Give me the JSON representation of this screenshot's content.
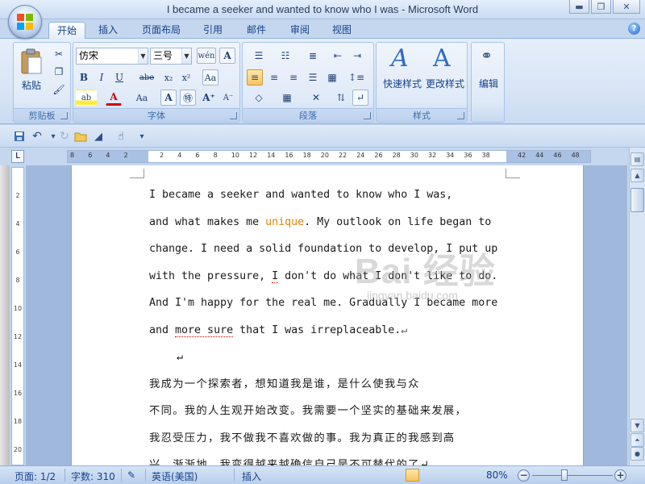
{
  "window": {
    "title": "I became a seeker and wanted to know who I was - Microsoft Word"
  },
  "tabs": [
    "开始",
    "插入",
    "页面布局",
    "引用",
    "邮件",
    "审阅",
    "视图"
  ],
  "ribbon": {
    "clipboard": {
      "paste_label": "粘贴",
      "group_label": "剪贴板"
    },
    "font": {
      "font_name": "仿宋",
      "font_size": "三号",
      "group_label": "字体"
    },
    "paragraph": {
      "group_label": "段落"
    },
    "styles": {
      "quick_styles_label": "快速样式",
      "change_styles_label": "更改样式",
      "group_label": "样式"
    },
    "editing": {
      "edit_label": "编辑"
    }
  },
  "ruler": {
    "tab_selector": "L",
    "ticks": [
      "8",
      "6",
      "4",
      "2",
      "",
      "2",
      "4",
      "6",
      "8",
      "10",
      "12",
      "14",
      "16",
      "18",
      "20",
      "22",
      "24",
      "26",
      "28",
      "30",
      "32",
      "34",
      "36",
      "38",
      "",
      "42",
      "44",
      "46",
      "48"
    ]
  },
  "vruler": {
    "ticks": [
      "2",
      "4",
      "6",
      "8",
      "10",
      "12",
      "14",
      "16",
      "18",
      "20"
    ]
  },
  "document": {
    "en_lines": [
      {
        "parts": [
          {
            "t": "    I became a seeker and wanted to know who I was,"
          }
        ]
      },
      {
        "parts": [
          {
            "t": "and what makes me "
          },
          {
            "t": "unique",
            "cls": "orange"
          },
          {
            "t": ". My outlook on life began to"
          }
        ]
      },
      {
        "parts": [
          {
            "t": "change. I need a solid foundation to develop, I put up"
          }
        ]
      },
      {
        "parts": [
          {
            "t": "with the pressure, "
          },
          {
            "t": "I",
            "cls": "uline"
          },
          {
            "t": " don't do what I don't like to do."
          }
        ]
      },
      {
        "parts": [
          {
            "t": "And I'm happy for the real me. Gradually I became more"
          }
        ]
      },
      {
        "parts": [
          {
            "t": "and "
          },
          {
            "t": "more sure",
            "cls": "uline"
          },
          {
            "t": " that I was irreplaceable."
          },
          {
            "t": "↵",
            "cls": "para-mark"
          }
        ]
      }
    ],
    "empty_mark": "↵",
    "cn_lines": [
      "    我成为一个探索者，想知道我是谁，是什么使我与众",
      "不同。我的人生观开始改变。我需要一个坚实的基础来发展，",
      "我忍受压力，我不做我不喜欢做的事。我为真正的我感到高",
      "兴。渐渐地，我变得越来越确信自己是不可替代的了↵"
    ]
  },
  "watermark": {
    "main": "Bai 经验",
    "sub": "jingyan.baidu.com"
  },
  "status": {
    "page": "页面: 1/2",
    "words": "字数: 310",
    "language": "英语(美国)",
    "mode": "插入",
    "zoom": "80%"
  }
}
